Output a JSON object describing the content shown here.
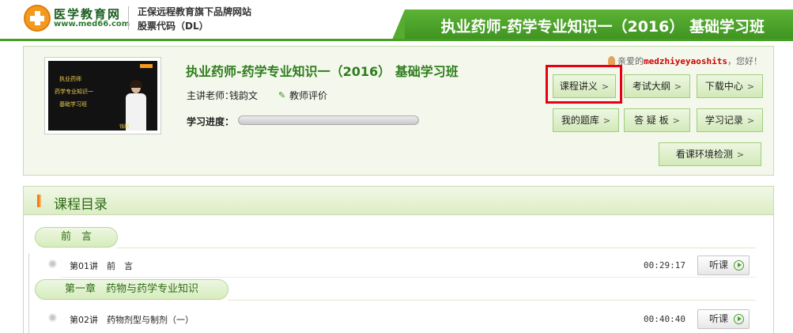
{
  "header": {
    "brand_name": "医学教育网",
    "brand_url": "www.med66.com",
    "slogan": "正保远程教育旗下品牌网站",
    "stock_code": "股票代码（DL）",
    "page_title": "执业药师-药学专业知识一（2016） 基础学习班"
  },
  "course": {
    "thumbnail_lines": [
      "执业药师",
      "药学专业知识一",
      "基础学习班"
    ],
    "thumbnail_tag": "钱韵",
    "title": "执业药师-药学专业知识一（2016） 基础学习班",
    "teacher_label": "主讲老师：",
    "teacher_name": "钱韵文",
    "teacher_eval": "教师评价",
    "progress_label": "学习进度：",
    "progress_fraction": 0.0,
    "greeting_prefix": "亲爱的",
    "username": "medzhiyeyaoshits",
    "greeting_suffix": "，您好！",
    "buttons": {
      "lecture_notes": "课程讲义",
      "exam_outline": "考试大纲",
      "download_center": "下载中心",
      "my_question_bank": "我的题库",
      "qa_board": "答 疑 板",
      "study_record": "学习记录",
      "env_check": "看课环境检测"
    }
  },
  "catalog": {
    "title": "课程目录",
    "chapters": [
      {
        "label": "前　言",
        "lessons": [
          {
            "title": "第01讲　前　言",
            "duration": "00:29:17",
            "action": "听课"
          }
        ]
      },
      {
        "label": "第一章　药物与药学专业知识",
        "lessons": [
          {
            "title": "第02讲　药物剂型与制剂（一）",
            "duration": "00:40:40",
            "action": "听课"
          }
        ]
      }
    ]
  },
  "colors": {
    "brand_green": "#47a025",
    "highlight_red": "#e60012",
    "accent_orange": "#f07c1e"
  }
}
